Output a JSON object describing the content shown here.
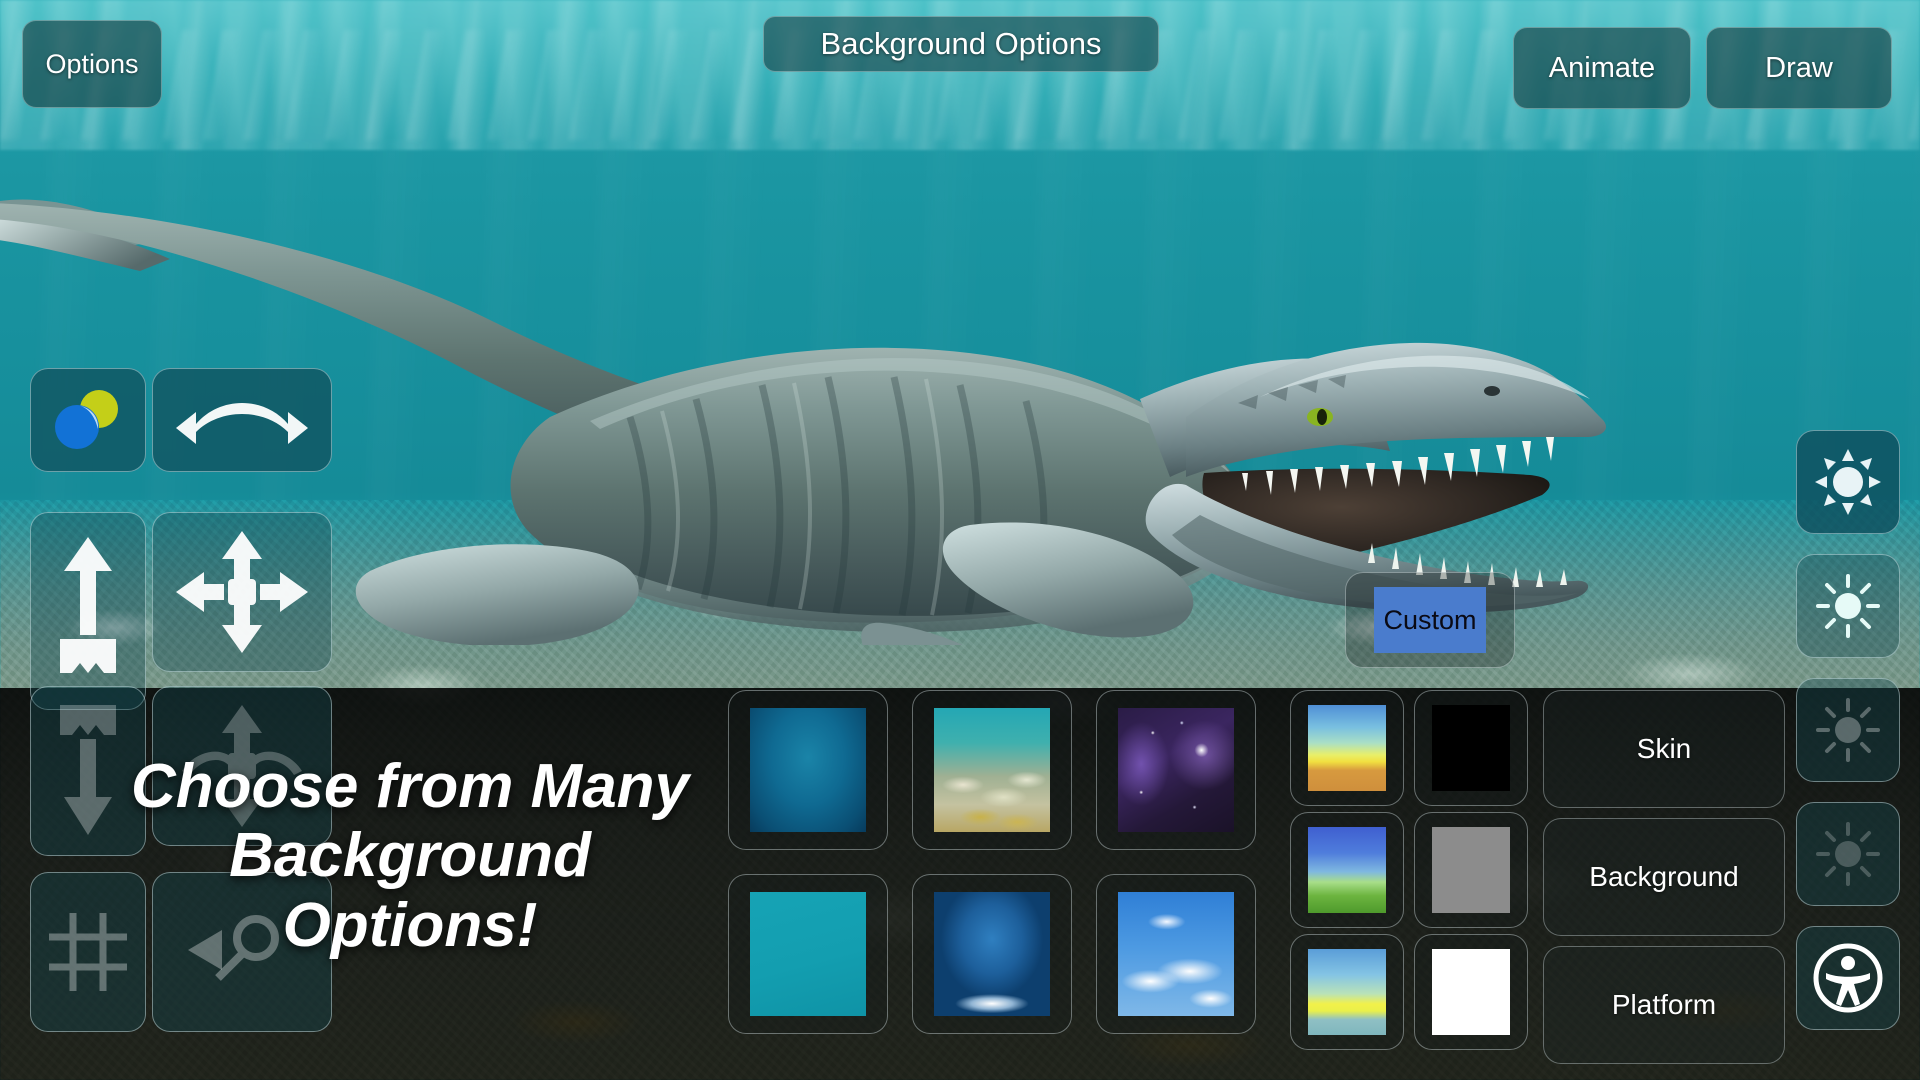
{
  "app": {
    "title": "Background Options"
  },
  "topbar": {
    "options_label": "Options",
    "animate_label": "Animate",
    "draw_label": "Draw"
  },
  "promo": {
    "line1": "Choose from Many",
    "line2": "Background",
    "line3": "Options!"
  },
  "left_tools": [
    {
      "name": "color-picker-icon",
      "label": "Color"
    },
    {
      "name": "rotate-horizontal-icon",
      "label": "Rotate"
    },
    {
      "name": "scale-up-icon",
      "label": "Scale"
    },
    {
      "name": "move-four-way-icon",
      "label": "Move"
    },
    {
      "name": "scale-down-icon",
      "label": "Lower"
    },
    {
      "name": "rotate-four-way-icon",
      "label": "Rotate 3D"
    },
    {
      "name": "grid-icon",
      "label": "Grid"
    },
    {
      "name": "zoom-icon",
      "label": "Zoom"
    }
  ],
  "right_tools": [
    {
      "name": "sun-bright-icon",
      "label": "Light 1"
    },
    {
      "name": "sun-medium-icon",
      "label": "Light 2"
    },
    {
      "name": "sun-dim-icon",
      "label": "Light 3"
    },
    {
      "name": "sun-faint-icon",
      "label": "Light 4"
    },
    {
      "name": "accessibility-icon",
      "label": "Accessibility"
    }
  ],
  "picker": {
    "custom_label": "Custom",
    "thumbnails": [
      {
        "id": "deep-ocean",
        "label": "Deep Ocean",
        "row": 1,
        "col": 1
      },
      {
        "id": "coral-reef",
        "label": "Coral Reef",
        "row": 1,
        "col": 2
      },
      {
        "id": "space-nebula",
        "label": "Space Nebula",
        "row": 1,
        "col": 3
      },
      {
        "id": "teal-flat",
        "label": "Teal Flat",
        "row": 2,
        "col": 1
      },
      {
        "id": "blue-studio",
        "label": "Blue Studio",
        "row": 2,
        "col": 2
      },
      {
        "id": "clouds-sky",
        "label": "Cloudy Sky",
        "row": 2,
        "col": 3
      }
    ],
    "swatches": [
      {
        "id": "desert-gradient",
        "label": "Desert Gradient"
      },
      {
        "id": "black",
        "label": "Black",
        "color": "#000000"
      },
      {
        "id": "grass-gradient",
        "label": "Grass Gradient"
      },
      {
        "id": "grey",
        "label": "Grey",
        "color": "#8c8c8c"
      },
      {
        "id": "beach-gradient",
        "label": "Beach Gradient"
      },
      {
        "id": "white",
        "label": "White",
        "color": "#ffffff"
      }
    ],
    "categories": {
      "skin_label": "Skin",
      "background_label": "Background",
      "platform_label": "Platform"
    }
  },
  "colors": {
    "water_teal": "#18919a",
    "custom_chip": "#4a7ccd",
    "accent_white": "#ffffff",
    "panel_dark": "rgba(0,0,0,0.82)"
  }
}
